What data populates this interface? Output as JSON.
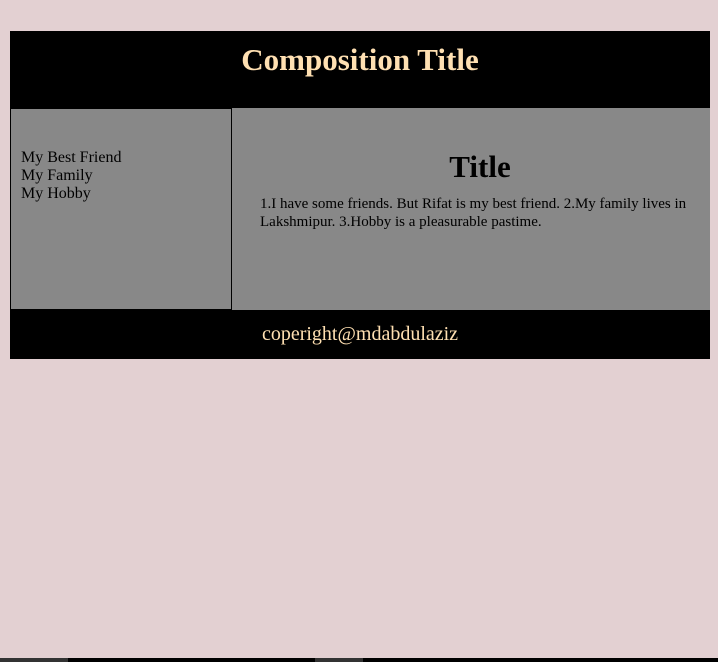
{
  "header": {
    "title": "Composition Title"
  },
  "sidebar": {
    "items": [
      {
        "label": "My Best Friend"
      },
      {
        "label": "My Family"
      },
      {
        "label": "My Hobby"
      }
    ]
  },
  "main": {
    "title": "Title",
    "text": "1.I have some friends. But Rifat is my best friend. 2.My family lives in Lakshmipur. 3.Hobby is a pleasurable pastime."
  },
  "footer": {
    "text": "coperight@mdabdulaziz"
  },
  "colors": {
    "page_background": "#e3d0d2",
    "header_background": "#000000",
    "title_color": "#ffe0b2",
    "panel_background": "#888888"
  }
}
